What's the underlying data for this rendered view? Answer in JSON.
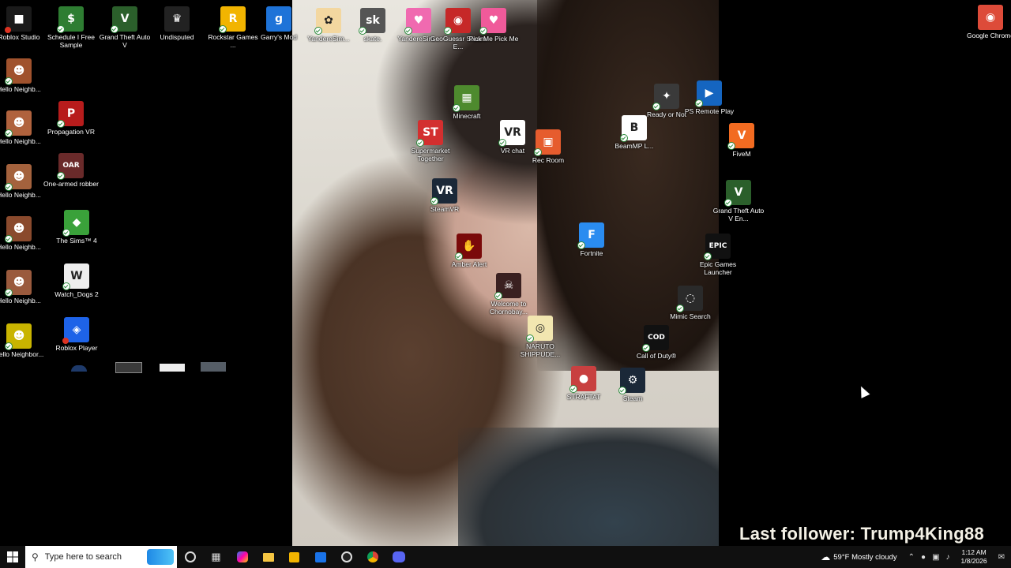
{
  "desktop": {
    "icons_left": [
      {
        "label": "Roblox Studio",
        "color": "#1a1a1a",
        "glyph": "■",
        "badge": "x"
      },
      {
        "label": "Schedule I Free Sample",
        "color": "#2e7d32",
        "glyph": "$",
        "badge": "check"
      },
      {
        "label": "Grand Theft Auto V",
        "color": "#2b5f2b",
        "glyph": "V",
        "badge": "check"
      },
      {
        "label": "Undisputed",
        "color": "#222222",
        "glyph": "♛",
        "badge": "none"
      },
      {
        "label": "Rockstar Games ...",
        "color": "#f2b400",
        "glyph": "R",
        "badge": "check"
      },
      {
        "label": "Garry's Mod",
        "color": "#1e73d8",
        "glyph": "g",
        "badge": "none"
      },
      {
        "label": "Hello Neighb...",
        "color": "#a0522d",
        "glyph": "☻",
        "badge": "check"
      },
      {
        "label": "Propagation VR",
        "color": "#b71c1c",
        "glyph": "P",
        "badge": "check"
      },
      {
        "label": "Hello Neighb...",
        "color": "#b0623d",
        "glyph": "☻",
        "badge": "check"
      },
      {
        "label": "One-armed robber",
        "color": "#6a2a2a",
        "glyph": "OAR",
        "badge": "check"
      },
      {
        "label": "Hello Neighb...",
        "color": "#a4623d",
        "glyph": "☻",
        "badge": "check"
      },
      {
        "label": "The Sims™ 4",
        "color": "#3aa13a",
        "glyph": "◆",
        "badge": "check"
      },
      {
        "label": "Hello Neighb...",
        "color": "#8a4a2d",
        "glyph": "☻",
        "badge": "check"
      },
      {
        "label": "Watch_Dogs 2",
        "color": "#eeeeee",
        "glyph": "W",
        "badge": "check"
      },
      {
        "label": "Hello Neighb...",
        "color": "#9a5a3d",
        "glyph": "☻",
        "badge": "check"
      },
      {
        "label": "Roblox Player",
        "color": "#1e63e8",
        "glyph": "◈",
        "badge": "x"
      },
      {
        "label": "Hello Neighbor...",
        "color": "#c9b400",
        "glyph": "☻",
        "badge": "check"
      }
    ],
    "icons_wallpaper": [
      {
        "label": "YandereSim...",
        "color": "#f3d7a0",
        "glyph": "✿"
      },
      {
        "label": "skate.",
        "color": "#555555",
        "glyph": "sk"
      },
      {
        "label": "YandereSim...",
        "color": "#f06ab0",
        "glyph": "♥"
      },
      {
        "label": "GeoGuessr Steam E...",
        "color": "#c62828",
        "glyph": "◉"
      },
      {
        "label": "Pick Me Pick Me",
        "color": "#f05a9a",
        "glyph": "♥"
      },
      {
        "label": "Minecraft",
        "color": "#4e8a2e",
        "glyph": "▦"
      },
      {
        "label": "Supermarket Together",
        "color": "#d32f2f",
        "glyph": "ST"
      },
      {
        "label": "VR chat",
        "color": "#ffffff",
        "glyph": "VR"
      },
      {
        "label": "Rec Room",
        "color": "#e65c2e",
        "glyph": "▣"
      },
      {
        "label": "Ready or Not",
        "color": "#3a3a3a",
        "glyph": "✦"
      },
      {
        "label": "PS Remote Play",
        "color": "#1565c0",
        "glyph": "▶"
      },
      {
        "label": "BeamMP L...",
        "color": "#ffffff",
        "glyph": "B"
      },
      {
        "label": "FiveM",
        "color": "#f26b21",
        "glyph": "V"
      },
      {
        "label": "SteamVR",
        "color": "#1b2838",
        "glyph": "VR"
      },
      {
        "label": "Grand Theft Auto V En...",
        "color": "#2b5f2b",
        "glyph": "V"
      },
      {
        "label": "Fortnite",
        "color": "#2a8cf0",
        "glyph": "F"
      },
      {
        "label": "Epic Games Launcher",
        "color": "#111111",
        "glyph": "EPIC"
      },
      {
        "label": "Amber Alert",
        "color": "#7a0a0a",
        "glyph": "✋"
      },
      {
        "label": "Welcome to Chornobay...",
        "color": "#3a2020",
        "glyph": "☠"
      },
      {
        "label": "Mimic Search",
        "color": "#2a2a2a",
        "glyph": "◌"
      },
      {
        "label": "NARUTO SHIPPUDE...",
        "color": "#f2e6b0",
        "glyph": "◎"
      },
      {
        "label": "Call of Duty®",
        "color": "#111111",
        "glyph": "COD"
      },
      {
        "label": "STRAFTAT",
        "color": "#c84040",
        "glyph": "●"
      },
      {
        "label": "Steam",
        "color": "#1b2838",
        "glyph": "⚙"
      }
    ],
    "icons_right": [
      {
        "label": "Google Chrome",
        "color": "#dd4b39",
        "glyph": "◉"
      }
    ]
  },
  "overlay": {
    "follower_text": "Last follower: Trump4King88"
  },
  "taskbar": {
    "search_placeholder": "Type here to search",
    "apps": [
      "cortana-icon",
      "task-view-icon",
      "copilot-icon",
      "file-explorer-icon",
      "store-icon",
      "outlook-icon",
      "obs-icon",
      "chrome-icon",
      "discord-icon"
    ],
    "weather": "59°F  Mostly cloudy",
    "time": "1:12 AM",
    "date": "1/8/2026"
  }
}
